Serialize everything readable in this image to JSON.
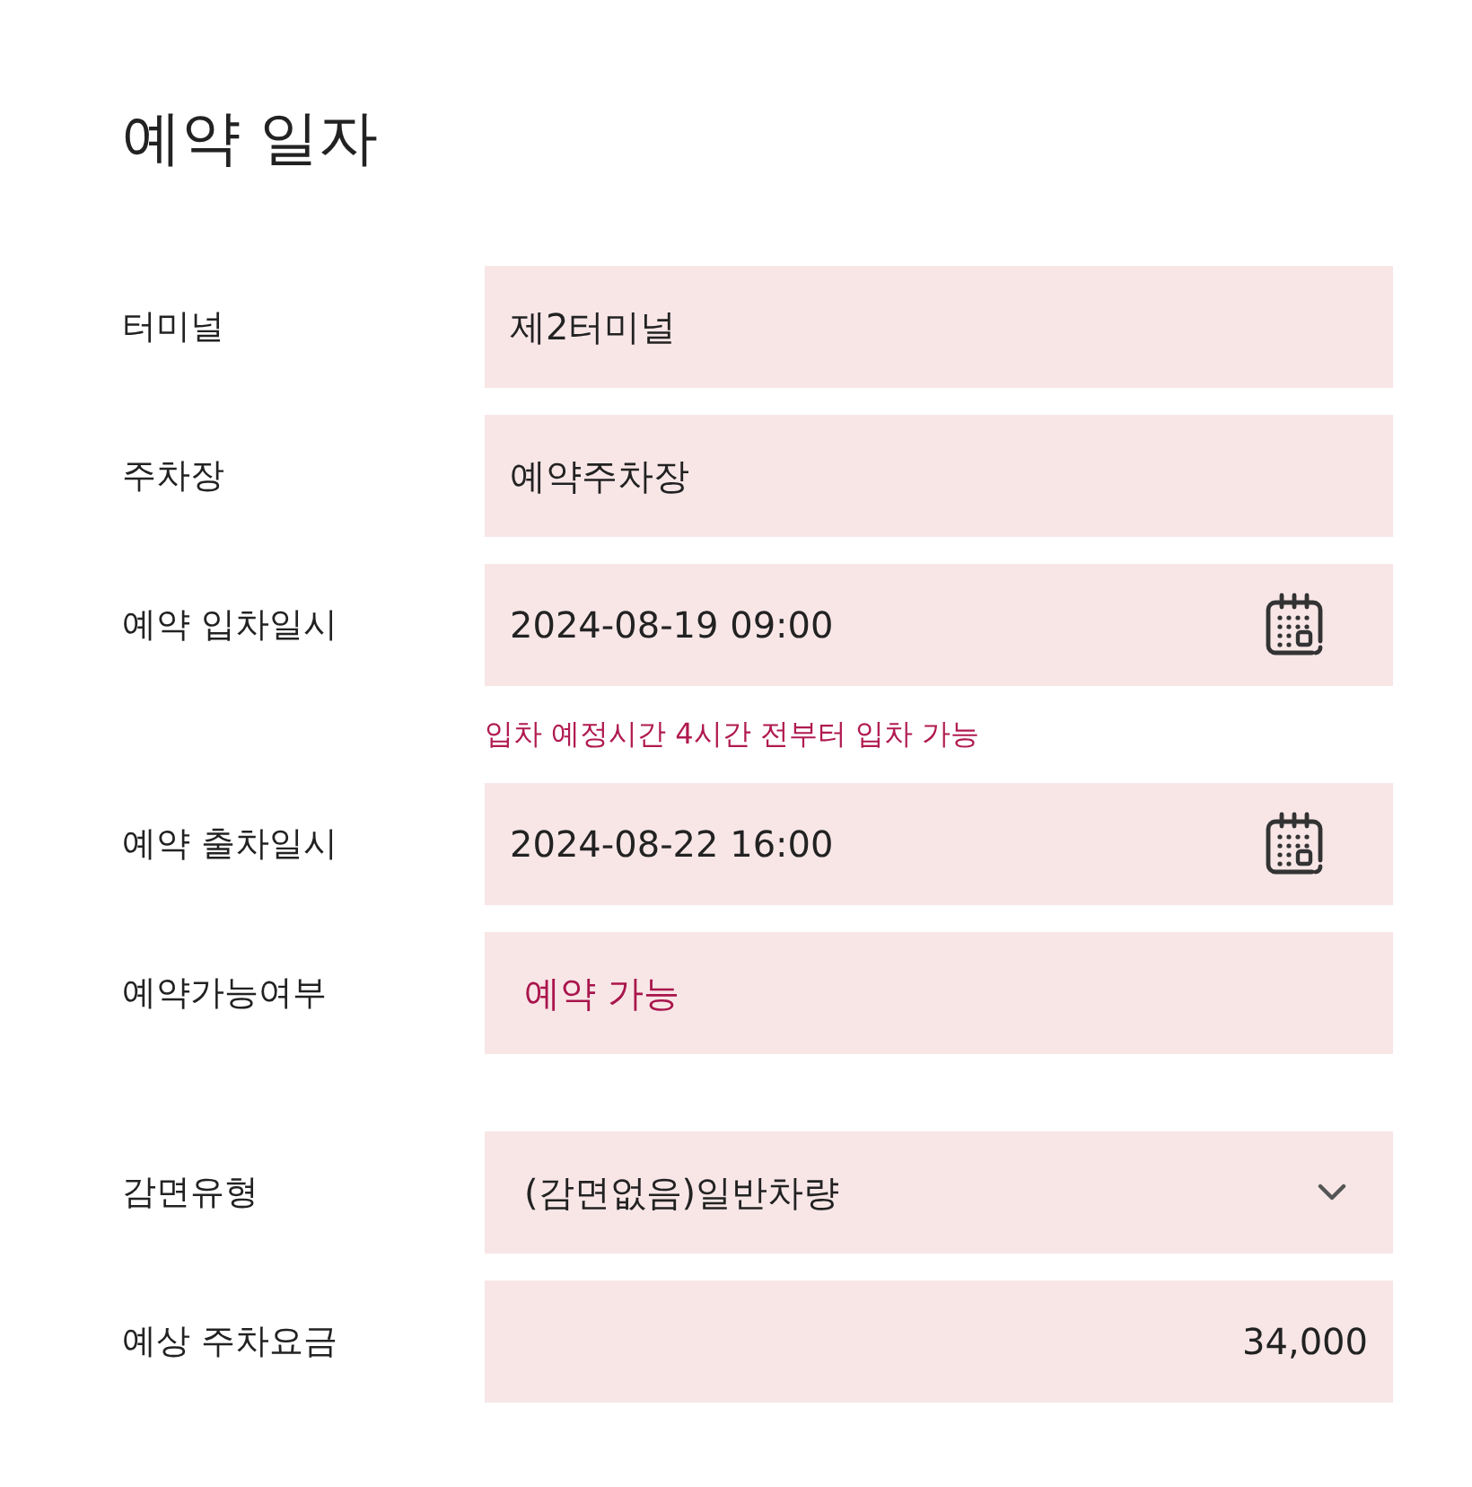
{
  "title": "예약 일자",
  "groups": [
    [
      {
        "kind": "text",
        "label": "터미널",
        "value": "제2터미널"
      },
      {
        "kind": "text",
        "label": "주차장",
        "value": "예약주차장"
      },
      {
        "kind": "date",
        "label": "예약 입차일시",
        "value": "2024-08-19 09:00",
        "hint": "입차 예정시간 4시간 전부터 입차 가능"
      },
      {
        "kind": "date",
        "label": "예약 출차일시",
        "value": "2024-08-22 16:00"
      },
      {
        "kind": "status",
        "label": "예약가능여부",
        "value": "예약 가능"
      }
    ],
    [
      {
        "kind": "select",
        "label": "감면유형",
        "value": "(감면없음)일반차량"
      },
      {
        "kind": "amount",
        "label": "예상 주차요금",
        "value": "34,000"
      }
    ]
  ]
}
